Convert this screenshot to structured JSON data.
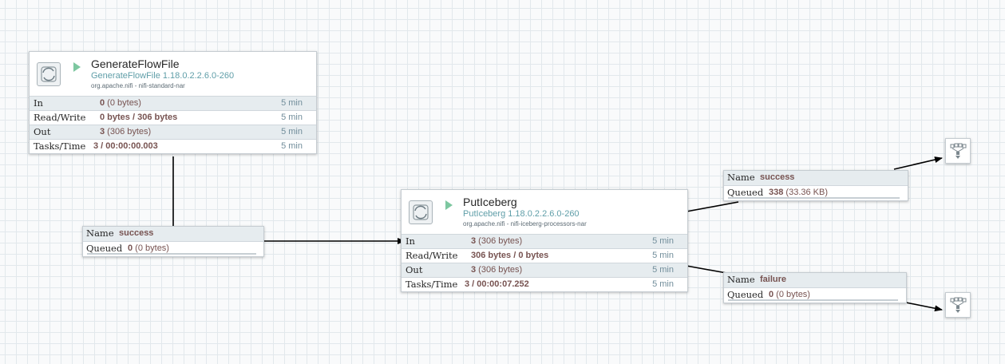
{
  "processors": [
    {
      "name": "GenerateFlowFile",
      "type": "GenerateFlowFile 1.18.0.2.2.6.0-260",
      "bundle": "org.apache.nifi - nifi-standard-nar",
      "stats": [
        {
          "label": "In",
          "value_bold": "0",
          "value_rest": " (0 bytes)",
          "time": "5 min"
        },
        {
          "label": "Read/Write",
          "value_bold": "0 bytes / 306 bytes",
          "value_rest": "",
          "time": "5 min"
        },
        {
          "label": "Out",
          "value_bold": "3",
          "value_rest": " (306 bytes)",
          "time": "5 min"
        },
        {
          "label": "Tasks/Time",
          "value_bold": "3 / 00:00:00.003",
          "value_rest": "",
          "time": "5 min"
        }
      ]
    },
    {
      "name": "PutIceberg",
      "type": "PutIceberg 1.18.0.2.2.6.0-260",
      "bundle": "org.apache.nifi - nifi-iceberg-processors-nar",
      "stats": [
        {
          "label": "In",
          "value_bold": "3",
          "value_rest": " (306 bytes)",
          "time": "5 min"
        },
        {
          "label": "Read/Write",
          "value_bold": "306 bytes / 0 bytes",
          "value_rest": "",
          "time": "5 min"
        },
        {
          "label": "Out",
          "value_bold": "3",
          "value_rest": " (306 bytes)",
          "time": "5 min"
        },
        {
          "label": "Tasks/Time",
          "value_bold": "3 / 00:00:07.252",
          "value_rest": "",
          "time": "5 min"
        }
      ]
    }
  ],
  "connections": [
    {
      "name_label": "Name",
      "name": "success",
      "queued_label": "Queued",
      "queued_bold": "0",
      "queued_rest": " (0 bytes)"
    },
    {
      "name_label": "Name",
      "name": "success",
      "queued_label": "Queued",
      "queued_bold": "338",
      "queued_rest": " (33.36 KB)"
    },
    {
      "name_label": "Name",
      "name": "failure",
      "queued_label": "Queued",
      "queued_bold": "0",
      "queued_rest": " (0 bytes)"
    }
  ],
  "funnels": [
    {
      "icon": "funnel-icon"
    },
    {
      "icon": "funnel-icon"
    }
  ],
  "colors": {
    "value_text": "#775351",
    "type_text": "#5f9ea8",
    "run_icon": "#7dc7a0",
    "edge": "#000000",
    "canvas_grid": "#e2e8ec"
  }
}
